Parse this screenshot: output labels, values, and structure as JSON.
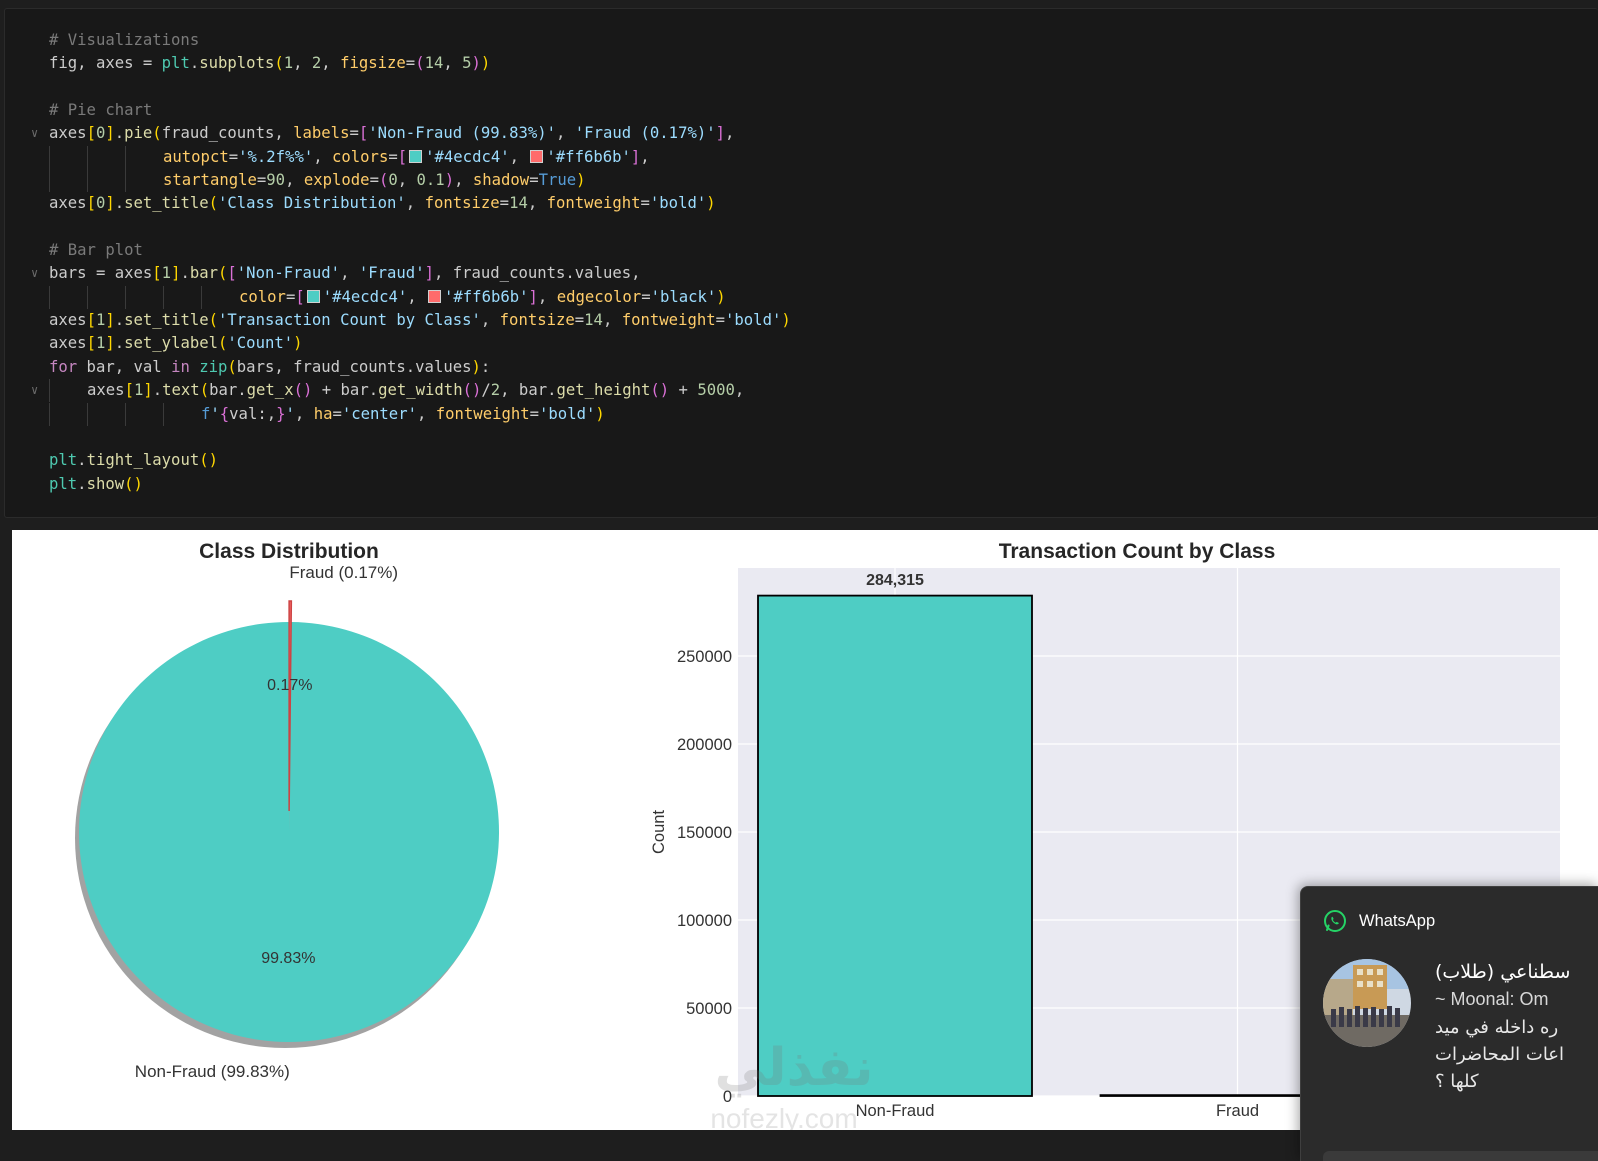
{
  "code_cell": {
    "lines": [
      {
        "segs": [
          {
            "t": "# Visualizations",
            "c": "c"
          }
        ]
      },
      {
        "segs": [
          {
            "t": "fig, axes = ",
            "c": ""
          },
          {
            "t": "plt",
            "c": "bi"
          },
          {
            "t": ".",
            "c": ""
          },
          {
            "t": "subplots",
            "c": "fn"
          },
          {
            "t": "(",
            "c": "br1"
          },
          {
            "t": "1",
            "c": "num"
          },
          {
            "t": ", ",
            "c": ""
          },
          {
            "t": "2",
            "c": "num"
          },
          {
            "t": ", ",
            "c": ""
          },
          {
            "t": "figsize",
            "c": "prm"
          },
          {
            "t": "=",
            "c": ""
          },
          {
            "t": "(",
            "c": "br2"
          },
          {
            "t": "14",
            "c": "num"
          },
          {
            "t": ", ",
            "c": ""
          },
          {
            "t": "5",
            "c": "num"
          },
          {
            "t": ")",
            "c": "br2"
          },
          {
            "t": ")",
            "c": "br1"
          }
        ]
      },
      {
        "segs": []
      },
      {
        "segs": [
          {
            "t": "# Pie chart",
            "c": "c"
          }
        ]
      },
      {
        "fold": true,
        "segs": [
          {
            "t": "axes",
            "c": ""
          },
          {
            "t": "[",
            "c": "br1"
          },
          {
            "t": "0",
            "c": "num"
          },
          {
            "t": "]",
            "c": "br1"
          },
          {
            "t": ".",
            "c": ""
          },
          {
            "t": "pie",
            "c": "fn"
          },
          {
            "t": "(",
            "c": "br1"
          },
          {
            "t": "fraud_counts, ",
            "c": ""
          },
          {
            "t": "labels",
            "c": "prm"
          },
          {
            "t": "=",
            "c": ""
          },
          {
            "t": "[",
            "c": "br2"
          },
          {
            "t": "'Non-Fraud (99.83%)'",
            "c": "str"
          },
          {
            "t": ", ",
            "c": ""
          },
          {
            "t": "'Fraud (0.17%)'",
            "c": "str"
          },
          {
            "t": "]",
            "c": "br2"
          },
          {
            "t": ",",
            "c": ""
          }
        ]
      },
      {
        "guides": 3,
        "segs": [
          {
            "t": "autopct",
            "c": "prm"
          },
          {
            "t": "=",
            "c": ""
          },
          {
            "t": "'%.2f%%'",
            "c": "str"
          },
          {
            "t": ", ",
            "c": ""
          },
          {
            "t": "colors",
            "c": "prm"
          },
          {
            "t": "=",
            "c": ""
          },
          {
            "t": "[",
            "c": "br2"
          },
          {
            "sw": "#4ecdc4"
          },
          {
            "t": "'#4ecdc4'",
            "c": "str"
          },
          {
            "t": ", ",
            "c": ""
          },
          {
            "sw": "#ff6b6b"
          },
          {
            "t": "'#ff6b6b'",
            "c": "str"
          },
          {
            "t": "]",
            "c": "br2"
          },
          {
            "t": ",",
            "c": ""
          }
        ]
      },
      {
        "guides": 3,
        "segs": [
          {
            "t": "startangle",
            "c": "prm"
          },
          {
            "t": "=",
            "c": ""
          },
          {
            "t": "90",
            "c": "num"
          },
          {
            "t": ", ",
            "c": ""
          },
          {
            "t": "explode",
            "c": "prm"
          },
          {
            "t": "=",
            "c": ""
          },
          {
            "t": "(",
            "c": "br2"
          },
          {
            "t": "0",
            "c": "num"
          },
          {
            "t": ", ",
            "c": ""
          },
          {
            "t": "0.1",
            "c": "num"
          },
          {
            "t": ")",
            "c": "br2"
          },
          {
            "t": ", ",
            "c": ""
          },
          {
            "t": "shadow",
            "c": "prm"
          },
          {
            "t": "=",
            "c": ""
          },
          {
            "t": "True",
            "c": "tru"
          },
          {
            "t": ")",
            "c": "br1"
          }
        ]
      },
      {
        "segs": [
          {
            "t": "axes",
            "c": ""
          },
          {
            "t": "[",
            "c": "br1"
          },
          {
            "t": "0",
            "c": "num"
          },
          {
            "t": "]",
            "c": "br1"
          },
          {
            "t": ".",
            "c": ""
          },
          {
            "t": "set_title",
            "c": "fn"
          },
          {
            "t": "(",
            "c": "br1"
          },
          {
            "t": "'Class Distribution'",
            "c": "str"
          },
          {
            "t": ", ",
            "c": ""
          },
          {
            "t": "fontsize",
            "c": "prm"
          },
          {
            "t": "=",
            "c": ""
          },
          {
            "t": "14",
            "c": "num"
          },
          {
            "t": ", ",
            "c": ""
          },
          {
            "t": "fontweight",
            "c": "prm"
          },
          {
            "t": "=",
            "c": ""
          },
          {
            "t": "'bold'",
            "c": "str"
          },
          {
            "t": ")",
            "c": "br1"
          }
        ]
      },
      {
        "segs": []
      },
      {
        "segs": [
          {
            "t": "# Bar plot",
            "c": "c"
          }
        ]
      },
      {
        "fold": true,
        "segs": [
          {
            "t": "bars = axes",
            "c": ""
          },
          {
            "t": "[",
            "c": "br1"
          },
          {
            "t": "1",
            "c": "num"
          },
          {
            "t": "]",
            "c": "br1"
          },
          {
            "t": ".",
            "c": ""
          },
          {
            "t": "bar",
            "c": "fn"
          },
          {
            "t": "(",
            "c": "br1"
          },
          {
            "t": "[",
            "c": "br2"
          },
          {
            "t": "'Non-Fraud'",
            "c": "str"
          },
          {
            "t": ", ",
            "c": ""
          },
          {
            "t": "'Fraud'",
            "c": "str"
          },
          {
            "t": "]",
            "c": "br2"
          },
          {
            "t": ", fraud_counts.values,",
            "c": ""
          }
        ]
      },
      {
        "guides": 5,
        "segs": [
          {
            "t": "color",
            "c": "prm"
          },
          {
            "t": "=",
            "c": ""
          },
          {
            "t": "[",
            "c": "br2"
          },
          {
            "sw": "#4ecdc4"
          },
          {
            "t": "'#4ecdc4'",
            "c": "str"
          },
          {
            "t": ", ",
            "c": ""
          },
          {
            "sw": "#ff6b6b"
          },
          {
            "t": "'#ff6b6b'",
            "c": "str"
          },
          {
            "t": "]",
            "c": "br2"
          },
          {
            "t": ", ",
            "c": ""
          },
          {
            "t": "edgecolor",
            "c": "prm"
          },
          {
            "t": "=",
            "c": ""
          },
          {
            "t": "'black'",
            "c": "str"
          },
          {
            "t": ")",
            "c": "br1"
          }
        ]
      },
      {
        "segs": [
          {
            "t": "axes",
            "c": ""
          },
          {
            "t": "[",
            "c": "br1"
          },
          {
            "t": "1",
            "c": "num"
          },
          {
            "t": "]",
            "c": "br1"
          },
          {
            "t": ".",
            "c": ""
          },
          {
            "t": "set_title",
            "c": "fn"
          },
          {
            "t": "(",
            "c": "br1"
          },
          {
            "t": "'Transaction Count by Class'",
            "c": "str"
          },
          {
            "t": ", ",
            "c": ""
          },
          {
            "t": "fontsize",
            "c": "prm"
          },
          {
            "t": "=",
            "c": ""
          },
          {
            "t": "14",
            "c": "num"
          },
          {
            "t": ", ",
            "c": ""
          },
          {
            "t": "fontweight",
            "c": "prm"
          },
          {
            "t": "=",
            "c": ""
          },
          {
            "t": "'bold'",
            "c": "str"
          },
          {
            "t": ")",
            "c": "br1"
          }
        ]
      },
      {
        "segs": [
          {
            "t": "axes",
            "c": ""
          },
          {
            "t": "[",
            "c": "br1"
          },
          {
            "t": "1",
            "c": "num"
          },
          {
            "t": "]",
            "c": "br1"
          },
          {
            "t": ".",
            "c": ""
          },
          {
            "t": "set_ylabel",
            "c": "fn"
          },
          {
            "t": "(",
            "c": "br1"
          },
          {
            "t": "'Count'",
            "c": "str"
          },
          {
            "t": ")",
            "c": "br1"
          }
        ]
      },
      {
        "segs": [
          {
            "t": "for",
            "c": "kw"
          },
          {
            "t": " bar, val ",
            "c": ""
          },
          {
            "t": "in",
            "c": "kw"
          },
          {
            "t": " ",
            "c": ""
          },
          {
            "t": "zip",
            "c": "bi"
          },
          {
            "t": "(",
            "c": "br1"
          },
          {
            "t": "bars, fraud_counts.values",
            "c": ""
          },
          {
            "t": ")",
            "c": "br1"
          },
          {
            "t": ":",
            "c": ""
          }
        ]
      },
      {
        "fold": true,
        "guides": 1,
        "segs": [
          {
            "t": "axes",
            "c": ""
          },
          {
            "t": "[",
            "c": "br1"
          },
          {
            "t": "1",
            "c": "num"
          },
          {
            "t": "]",
            "c": "br1"
          },
          {
            "t": ".",
            "c": ""
          },
          {
            "t": "text",
            "c": "fn"
          },
          {
            "t": "(",
            "c": "br1"
          },
          {
            "t": "bar.",
            "c": ""
          },
          {
            "t": "get_x",
            "c": "fn"
          },
          {
            "t": "()",
            "c": "br2"
          },
          {
            "t": " + bar.",
            "c": ""
          },
          {
            "t": "get_width",
            "c": "fn"
          },
          {
            "t": "()",
            "c": "br2"
          },
          {
            "t": "/",
            "c": ""
          },
          {
            "t": "2",
            "c": "num"
          },
          {
            "t": ", bar.",
            "c": ""
          },
          {
            "t": "get_height",
            "c": "fn"
          },
          {
            "t": "()",
            "c": "br2"
          },
          {
            "t": " + ",
            "c": ""
          },
          {
            "t": "5000",
            "c": "num"
          },
          {
            "t": ",",
            "c": ""
          }
        ]
      },
      {
        "guides": 4,
        "segs": [
          {
            "t": "f",
            "c": "tru"
          },
          {
            "t": "'",
            "c": "str"
          },
          {
            "t": "{",
            "c": "br2"
          },
          {
            "t": "val:,",
            "c": ""
          },
          {
            "t": "}",
            "c": "br2"
          },
          {
            "t": "'",
            "c": "str"
          },
          {
            "t": ", ",
            "c": ""
          },
          {
            "t": "ha",
            "c": "prm"
          },
          {
            "t": "=",
            "c": ""
          },
          {
            "t": "'center'",
            "c": "str"
          },
          {
            "t": ", ",
            "c": ""
          },
          {
            "t": "fontweight",
            "c": "prm"
          },
          {
            "t": "=",
            "c": ""
          },
          {
            "t": "'bold'",
            "c": "str"
          },
          {
            "t": ")",
            "c": "br1"
          }
        ]
      },
      {
        "segs": []
      },
      {
        "segs": [
          {
            "t": "plt",
            "c": "bi"
          },
          {
            "t": ".",
            "c": ""
          },
          {
            "t": "tight_layout",
            "c": "fn"
          },
          {
            "t": "()",
            "c": "br1"
          }
        ]
      },
      {
        "segs": [
          {
            "t": "plt",
            "c": "bi"
          },
          {
            "t": ".",
            "c": ""
          },
          {
            "t": "show",
            "c": "fn"
          },
          {
            "t": "()",
            "c": "br1"
          }
        ]
      }
    ]
  },
  "chart_data": [
    {
      "type": "pie",
      "title": "Class Distribution",
      "slices": [
        {
          "label": "Non-Fraud (99.83%)",
          "pct_label": "99.83%",
          "value": 99.83,
          "color": "#4ecdc4",
          "explode": 0
        },
        {
          "label": "Fraud (0.17%)",
          "pct_label": "0.17%",
          "value": 0.17,
          "color": "#ff6b6b",
          "explode": 0.1
        }
      ],
      "startangle": 90,
      "shadow": true
    },
    {
      "type": "bar",
      "title": "Transaction Count by Class",
      "categories": [
        "Non-Fraud",
        "Fraud"
      ],
      "values": [
        284315,
        492
      ],
      "value_labels": [
        "284,315"
      ],
      "colors": [
        "#4ecdc4",
        "#ff6b6b"
      ],
      "edgecolor": "black",
      "ylabel": "Count",
      "ylim": [
        0,
        300000
      ],
      "yticks": [
        0,
        50000,
        100000,
        150000,
        200000,
        250000
      ],
      "ytick_labels": [
        "0",
        "50000",
        "100000",
        "150000",
        "200000",
        "250000"
      ],
      "grid": true,
      "background": "#eaeaf2"
    }
  ],
  "watermark": {
    "arabic": "نفذلي",
    "latin": "nofezly.com"
  },
  "notification": {
    "app": "WhatsApp",
    "title": "سطناعي (طلاب)",
    "sender": "~ Moonal:  Om",
    "body_lines": [
      "ره داخله في ميد",
      "اعات المحاضرات",
      "كلها ؟"
    ]
  }
}
